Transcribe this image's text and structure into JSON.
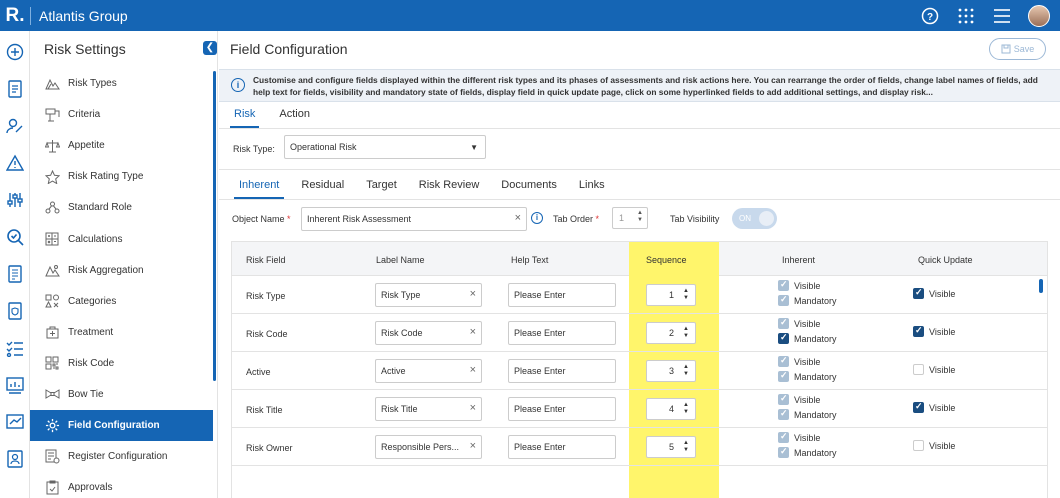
{
  "app": {
    "logo": "R.",
    "brand": "Atlantis Group"
  },
  "topbar": {
    "icons": [
      "help-icon",
      "apps-grid-icon",
      "menu-icon",
      "user-avatar"
    ]
  },
  "sidebar": {
    "title": "Risk Settings",
    "items": [
      {
        "label": "Risk Types",
        "icon": "risk-types-icon"
      },
      {
        "label": "Criteria",
        "icon": "criteria-icon"
      },
      {
        "label": "Appetite",
        "icon": "appetite-icon"
      },
      {
        "label": "Risk Rating Type",
        "icon": "star-icon"
      },
      {
        "label": "Standard Role",
        "icon": "role-icon"
      },
      {
        "label": "Calculations",
        "icon": "calculator-icon"
      },
      {
        "label": "Risk Aggregation",
        "icon": "aggregation-icon"
      },
      {
        "label": "Categories",
        "icon": "categories-icon"
      },
      {
        "label": "Treatment",
        "icon": "treatment-icon"
      },
      {
        "label": "Risk Code",
        "icon": "qr-code-icon"
      },
      {
        "label": "Bow Tie",
        "icon": "bow-tie-icon"
      },
      {
        "label": "Field Configuration",
        "icon": "gear-icon",
        "active": true
      },
      {
        "label": "Register Configuration",
        "icon": "register-icon"
      },
      {
        "label": "Approvals",
        "icon": "approvals-icon"
      }
    ]
  },
  "main": {
    "title": "Field Configuration",
    "save_label": "Save",
    "info_text": "Customise and configure fields displayed within the different risk types and its phases of assessments and risk actions here. You can rearrange the order of fields, change label names of fields, add help text for fields, visibility and mandatory state of fields, display field in quick update page, click on some hyperlinked fields to add additional settings, and display risk...",
    "tabs": [
      "Risk",
      "Action"
    ],
    "risk_type_label": "Risk Type:",
    "risk_type_value": "Operational Risk",
    "phase_tabs": [
      "Inherent",
      "Residual",
      "Target",
      "Risk Review",
      "Documents",
      "Links"
    ],
    "object_name_label": "Object Name",
    "object_name_value": "Inherent Risk Assessment",
    "tab_order_label": "Tab Order",
    "tab_order_value": "1",
    "tab_visibility_label": "Tab Visibility",
    "tab_visibility_value": "ON",
    "required_mark": "*"
  },
  "table": {
    "headers": [
      "Risk Field",
      "Label Name",
      "Help Text",
      "Sequence",
      "Inherent",
      "Quick Update"
    ],
    "help_placeholder": "Please Enter",
    "visible_label": "Visible",
    "mandatory_label": "Mandatory",
    "highlight_color": "#fff56b",
    "rows": [
      {
        "field": "Risk Type",
        "label": "Risk Type",
        "seq": "1",
        "inh_visible": "grey",
        "inh_mandatory": "grey",
        "quick": "blue"
      },
      {
        "field": "Risk Code",
        "label": "Risk Code",
        "seq": "2",
        "inh_visible": "grey",
        "inh_mandatory": "blue",
        "quick": "blue"
      },
      {
        "field": "Active",
        "label": "Active",
        "seq": "3",
        "inh_visible": "grey",
        "inh_mandatory": "grey",
        "quick": "empty"
      },
      {
        "field": "Risk Title",
        "label": "Risk Title",
        "seq": "4",
        "inh_visible": "grey",
        "inh_mandatory": "grey",
        "quick": "blue"
      },
      {
        "field": "Risk Owner",
        "label": "Responsible Pers...",
        "seq": "5",
        "inh_visible": "grey",
        "inh_mandatory": "grey",
        "quick": "empty"
      }
    ]
  },
  "colors": {
    "primary": "#1565b4",
    "checked_dark": "#1a4d80",
    "checked_disabled": "#a9bfd4"
  }
}
